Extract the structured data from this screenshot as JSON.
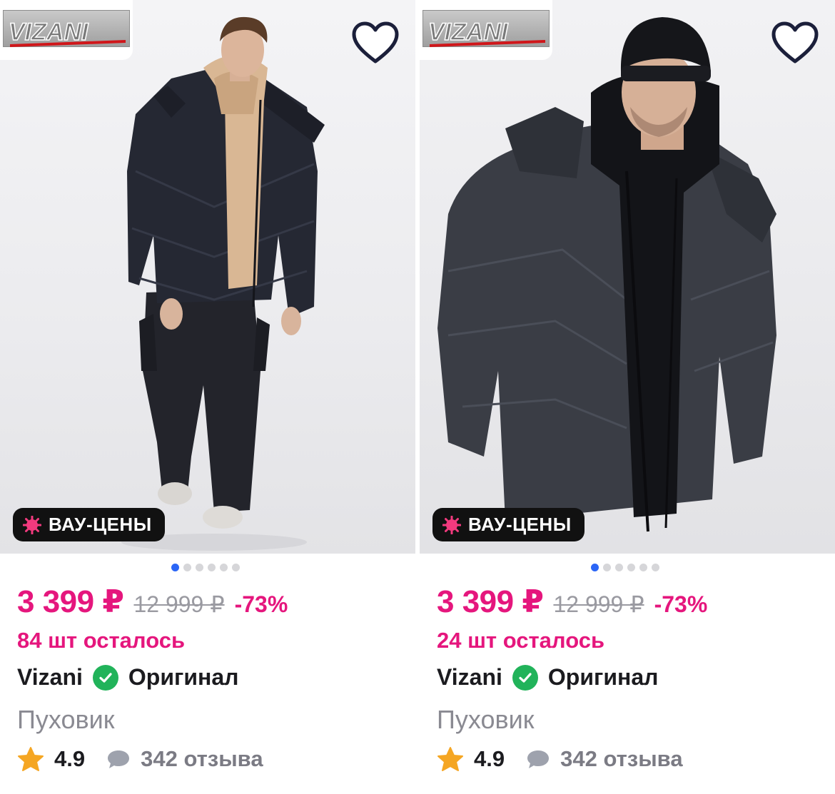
{
  "products": [
    {
      "brand_logo": "VIZANI",
      "favorite_icon": "heart-outline-icon",
      "promo_badge": "ВАУ-ЦЕНЫ",
      "price_current": "3 399 ₽",
      "price_old": "12 999 ₽",
      "discount": "-73%",
      "stock": "84 шт осталось",
      "brand": "Vizani",
      "original_label": "Оригинал",
      "name": "Пуховик",
      "rating": "4.9",
      "reviews": "342 отзыва",
      "slides_total": 6,
      "slide_active": 1
    },
    {
      "brand_logo": "VIZANI",
      "favorite_icon": "heart-outline-icon",
      "promo_badge": "ВАУ-ЦЕНЫ",
      "price_current": "3 399 ₽",
      "price_old": "12 999 ₽",
      "discount": "-73%",
      "stock": "24 шт осталось",
      "brand": "Vizani",
      "original_label": "Оригинал",
      "name": "Пуховик",
      "rating": "4.9",
      "reviews": "342 отзыва",
      "slides_total": 6,
      "slide_active": 1
    }
  ],
  "colors": {
    "accent_pink": "#e5167d",
    "check_green": "#21b35a",
    "star_orange": "#f5a623",
    "dot_active": "#2b66f6",
    "badge_bg": "#111111"
  }
}
